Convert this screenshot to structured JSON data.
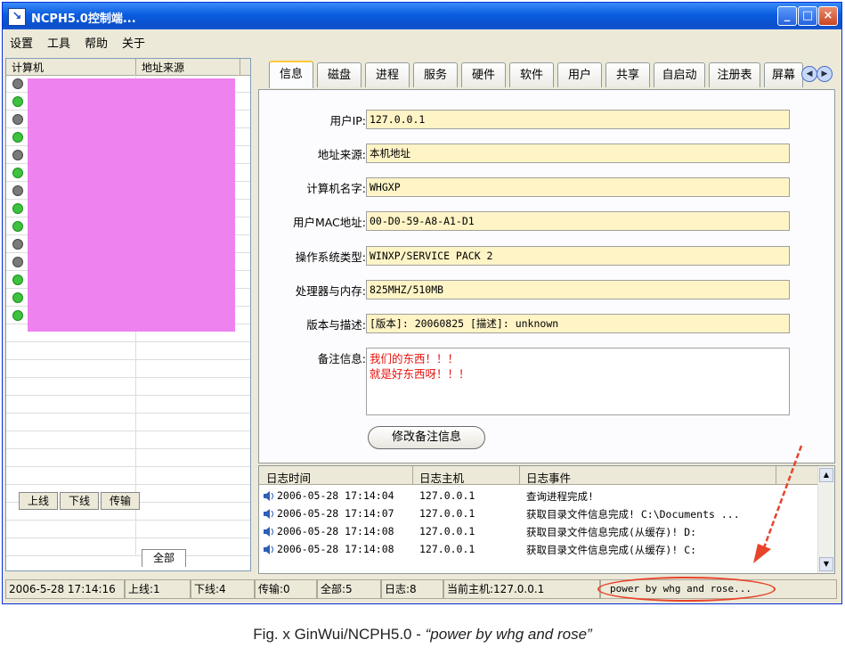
{
  "window": {
    "title": "NCPH5.0控制端...",
    "app_icon": "arrow-icon"
  },
  "title_buttons": {
    "minimize": "_",
    "maximize": "□",
    "close": "×"
  },
  "menu": [
    "设置",
    "工具",
    "帮助",
    "关于"
  ],
  "computer_list": {
    "columns": [
      "计算机",
      "地址来源"
    ],
    "rows": [
      {
        "status": "offline"
      },
      {
        "status": "online"
      },
      {
        "status": "offline"
      },
      {
        "status": "online"
      },
      {
        "status": "offline"
      },
      {
        "status": "online"
      },
      {
        "status": "offline"
      },
      {
        "status": "online"
      },
      {
        "status": "online"
      },
      {
        "status": "offline"
      },
      {
        "status": "offline"
      },
      {
        "status": "online"
      },
      {
        "status": "online"
      },
      {
        "status": "online"
      }
    ],
    "redaction_color": "#ee82ee"
  },
  "left_tabs": [
    "上线",
    "下线",
    "传输",
    "全部"
  ],
  "left_tabs_active": "全部",
  "tabs": [
    "信息",
    "磁盘",
    "进程",
    "服务",
    "硬件",
    "软件",
    "用户",
    "共享",
    "自启动",
    "注册表",
    "屏幕"
  ],
  "tabs_active": "信息",
  "info": {
    "fields": [
      {
        "label": "用户IP:",
        "value": "127.0.0.1"
      },
      {
        "label": "地址来源:",
        "value": "本机地址"
      },
      {
        "label": "计算机名字:",
        "value": "WHGXP"
      },
      {
        "label": "用户MAC地址:",
        "value": "00-D0-59-A8-A1-D1"
      },
      {
        "label": "操作系统类型:",
        "value": "WINXP/SERVICE PACK 2"
      },
      {
        "label": "处理器与内存:",
        "value": "825MHZ/510MB"
      },
      {
        "label": "版本与描述:",
        "value": "[版本]: 20060825   [描述]: unknown"
      }
    ],
    "notes_label": "备注信息:",
    "notes_lines": [
      "我们的东西！！！",
      "就是好东西呀！！！"
    ],
    "save_button": "修改备注信息"
  },
  "log": {
    "columns": [
      "日志时间",
      "日志主机",
      "日志事件"
    ],
    "rows": [
      {
        "time": "2006-05-28 17:14:04",
        "host": "127.0.0.1",
        "event": "查询进程完成!"
      },
      {
        "time": "2006-05-28 17:14:07",
        "host": "127.0.0.1",
        "event": "获取目录文件信息完成! C:\\Documents ..."
      },
      {
        "time": "2006-05-28 17:14:08",
        "host": "127.0.0.1",
        "event": "获取目录文件信息完成(从缓存)! D:"
      },
      {
        "time": "2006-05-28 17:14:08",
        "host": "127.0.0.1",
        "event": "获取目录文件信息完成(从缓存)! C:"
      }
    ]
  },
  "status": {
    "datetime": "2006-5-28 17:14:16",
    "online": "上线:1",
    "offline": "下线:4",
    "transfer": "传输:0",
    "all": "全部:5",
    "logs": "日志:8",
    "current_host": "当前主机:127.0.0.1",
    "power": "power by whg and rose..."
  },
  "caption": {
    "prefix": "Fig. x GinWui/NCPH5.0 - ",
    "quote": "“power by whg and rose”"
  },
  "colors": {
    "online": "#3cc23c",
    "offline": "#7a7a7a",
    "field_bg": "#fff4c6",
    "notes_text": "#e8120c",
    "annotation": "#e8432b"
  }
}
